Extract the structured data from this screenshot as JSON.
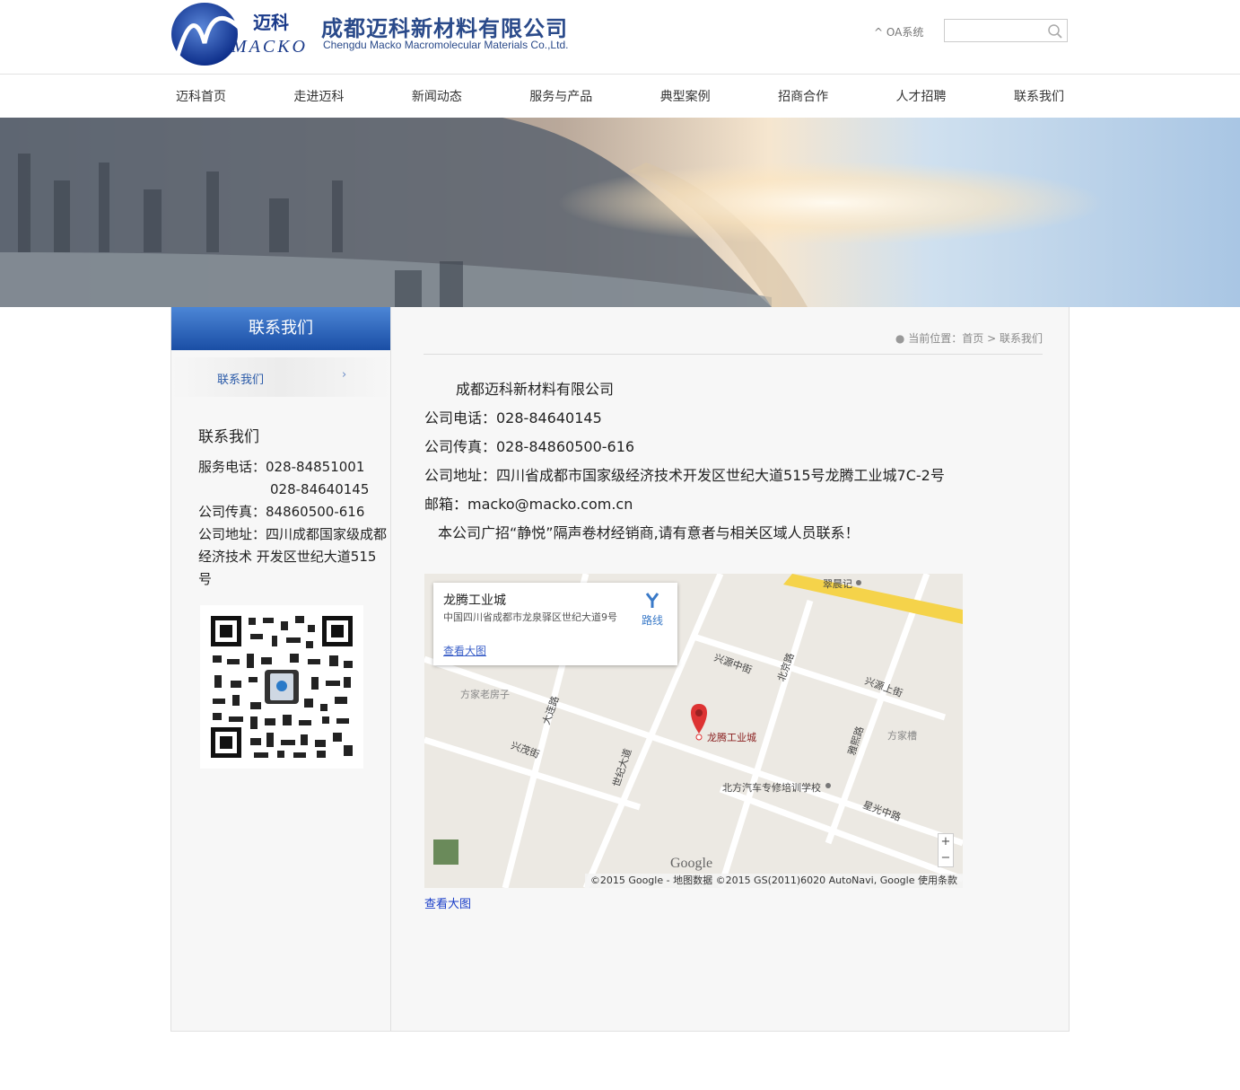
{
  "header": {
    "brand_cn": "成都迈科新材料有限公司",
    "brand_en": "Chengdu Macko Macromolecular Materials Co.,Ltd.",
    "logo_small_cn": "迈科",
    "logo_word": "MACKO",
    "oa_link": "^ OA系统",
    "search_placeholder": ""
  },
  "nav": {
    "items": [
      "迈科首页",
      "走进迈科",
      "新闻动态",
      "服务与产品",
      "典型案例",
      "招商合作",
      "人才招聘",
      "联系我们"
    ]
  },
  "sidebar": {
    "title": "联系我们",
    "menu_item": "联系我们",
    "menu_chevron": "›",
    "contact_heading": "联系我们",
    "service_phone_label": "服务电话：028-84851001",
    "service_phone_2": "028-84640145",
    "fax": "公司传真：84860500-616",
    "address": "公司地址：四川成都国家级成都经济技术 开发区世纪大道515号"
  },
  "breadcrumb": {
    "prefix": "当前位置：",
    "home": "首页",
    "sep": ">",
    "current": "联系我们"
  },
  "info": {
    "company": "成都迈科新材料有限公司",
    "phone": "公司电话：028-84640145",
    "fax": "公司传真：028-84860500-616",
    "address": "公司地址：四川省成都市国家级经济技术开发区世纪大道515号龙腾工业城7C-2号",
    "email": "邮箱：macko@macko.com.cn",
    "notice": "本公司广招“静悦”隔声卷材经销商,请有意者与相关区域人员联系！"
  },
  "map": {
    "info_title": "龙腾工业城",
    "info_addr": "中国四川省成都市龙泉驿区世纪大道9号",
    "info_big": "查看大图",
    "info_route": "路线",
    "marker_label": "龙腾工业城",
    "labels": {
      "cuichenji": "翠晨记",
      "xingyuanzhongjie": "兴源中街",
      "beijinglu": "北京路",
      "xingyuanshangjie": "兴源上街",
      "fangjialaofangzi": "方家老房子",
      "dalianlu": "大连路",
      "xingmaojie": "兴茂街",
      "shijidadao": "世纪大道",
      "yaxilu": "雅熙路",
      "fangjiacao": "方家槽",
      "beifang_school": "北方汽车专修培训学校",
      "xingguangzhonglu": "星光中路",
      "google": "Google"
    },
    "zoom_in": "+",
    "zoom_out": "−",
    "copyright": "©2015 Google - 地图数据 ©2015 GS(2011)6020 AutoNavi, Google   使用条款",
    "below_link": "查看大图"
  },
  "colors": {
    "brand": "#2a4a8a",
    "side_title_top": "#4c86d6",
    "side_title_bottom": "#1a4ea5",
    "link": "#1a3ec8"
  }
}
